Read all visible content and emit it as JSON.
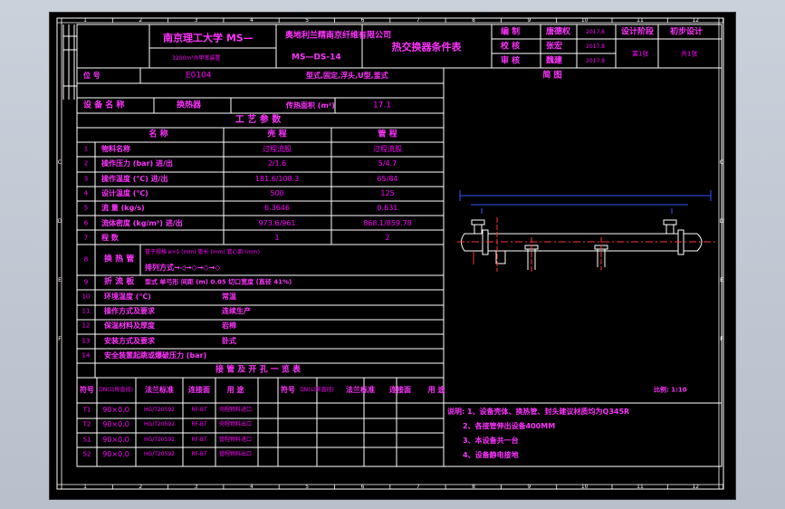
{
  "title_block": {
    "org": "南京理工大学 MS—",
    "sub_org": "3200m³/h甲苯装置",
    "project": "奥地利兰精南京纤维有限公司",
    "drawing_no": "MS—DS-14",
    "doc_title": "热交换器条件表",
    "roles": [
      "编  制",
      "校  核",
      "审  核"
    ],
    "names": [
      "唐德权",
      "张宏",
      "魏建"
    ],
    "dates": [
      "2017.8",
      "2017.8",
      "2017.8"
    ],
    "stage_label": "设计阶段",
    "stage_value": "初步设计",
    "page": "第1张",
    "total": "共1张"
  },
  "left_margin_letters": [
    "C",
    "D",
    "E",
    "F"
  ],
  "ruler_numbers": [
    "1",
    "2",
    "3",
    "4",
    "5",
    "6",
    "7",
    "8",
    "9",
    "10",
    "11",
    "12"
  ],
  "equip": {
    "tag_label": "位    号",
    "tag_value": "E0104",
    "type_value": "型式,固定,浮头,U型,釜式",
    "name_label": "设 备 名 称",
    "name_value": "换热器",
    "area_label": "传热面积 (m²)",
    "area_value": "17.1",
    "diagram_label": "简    图"
  },
  "process": {
    "header": "工  艺  参  数",
    "col_name": "名    称",
    "col_shell": "壳    程",
    "col_tube": "管    程",
    "rows": [
      {
        "no": "1",
        "name": "物料名称",
        "shell": "过程流股",
        "tube": "过程流股"
      },
      {
        "no": "2",
        "name": "操作压力 (bar) 进/出",
        "shell": "2/1.6",
        "tube": "5/4.7"
      },
      {
        "no": "3",
        "name": "操作温度 (℃) 进/出",
        "shell": "181.6/108.3",
        "tube": "65/84"
      },
      {
        "no": "4",
        "name": "设计温度 (℃)",
        "shell": "500",
        "tube": "125"
      },
      {
        "no": "5",
        "name": "流  量 (kg/s)",
        "shell": "6.3646",
        "tube": "0.631"
      },
      {
        "no": "6",
        "name": "流体密度 (kg/m³) 进/出",
        "shell": "973.6/961",
        "tube": "868.1/859.78"
      },
      {
        "no": "7",
        "name": "程 数",
        "shell": "1",
        "tube": "2"
      }
    ],
    "row8_no": "8",
    "row8_name": "换 热 管",
    "row8_a": "管子规格 ø×δ (mm)  管长 (mm)  管心距 (mm)",
    "row8_b": "排列方式→◁→◇→◇→◇",
    "row9_no": "9",
    "row9_name": "折 流 板",
    "row9_value": "型式 单弓形   间距 (m) 0.05   切口宽度 (直径 41%)",
    "rows_extra": [
      {
        "no": "10",
        "name": "环境温度 (℃)",
        "value": "常温"
      },
      {
        "no": "11",
        "name": "操作方式及要求",
        "value": "连续生产"
      },
      {
        "no": "12",
        "name": "保温材料及厚度",
        "value": "岩棉"
      },
      {
        "no": "13",
        "name": "安装方式及要求",
        "value": "卧式"
      },
      {
        "no": "14",
        "name": "安全装置起跳或爆破压力 (bar)",
        "value": ""
      }
    ]
  },
  "nozzles": {
    "header": "接 管 及 开 孔 一 览 表",
    "cols": [
      "符号",
      "DN(公称直径)",
      "法兰标准",
      "连接面",
      "用  途"
    ],
    "rows": [
      {
        "sym": "T1",
        "size": "90×0.0",
        "std": "HG/T20592",
        "face": "RF-BT",
        "use": "壳程物料进口"
      },
      {
        "sym": "T2",
        "size": "90×0.0",
        "std": "HG/T20592",
        "face": "RF-BT",
        "use": "壳程物料出口"
      },
      {
        "sym": "S1",
        "size": "90×0.0",
        "std": "HG/T20592",
        "face": "RF-BT",
        "use": "管程物料进口"
      },
      {
        "sym": "S2",
        "size": "90×0.0",
        "std": "HG/T20592",
        "face": "RF-BT",
        "use": "管程物料出口"
      }
    ]
  },
  "scale": "比例: 1:10",
  "notes": [
    "说明: 1、设备壳体、换热管、封头建议材质均为Q345R",
    "2、各接管伸出设备400MM",
    "3、本设备共一台",
    "4、设备静电接地"
  ]
}
